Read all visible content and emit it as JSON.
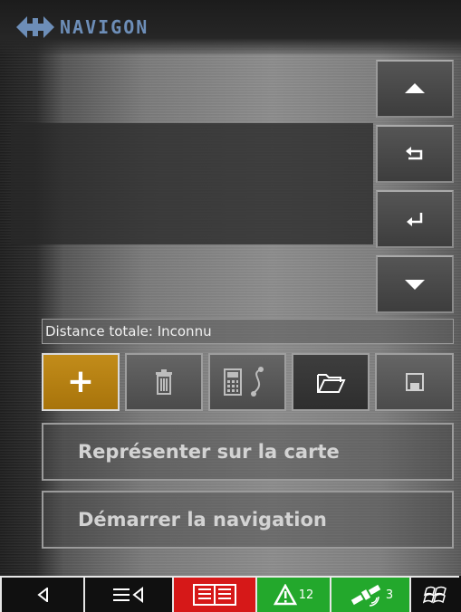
{
  "app": {
    "brand_name": "NAVIGON"
  },
  "route": {
    "distance_text": "Distance totale: Inconnu"
  },
  "side_nav": [
    "arrow-up-icon",
    "return-left-icon",
    "return-right-icon",
    "arrow-down-icon"
  ],
  "toolbar": {
    "add_label": "+"
  },
  "actions": {
    "show_on_map": "Représenter sur la carte",
    "start_navigation": "Démarrer la navigation"
  },
  "taskbar": {
    "warning_count": "12",
    "satellite_count": "3"
  },
  "colors": {
    "accent": "#b8800f",
    "brand": "#6d8eb8",
    "taskbar_red": "#d61818",
    "taskbar_green": "#23a82c"
  }
}
